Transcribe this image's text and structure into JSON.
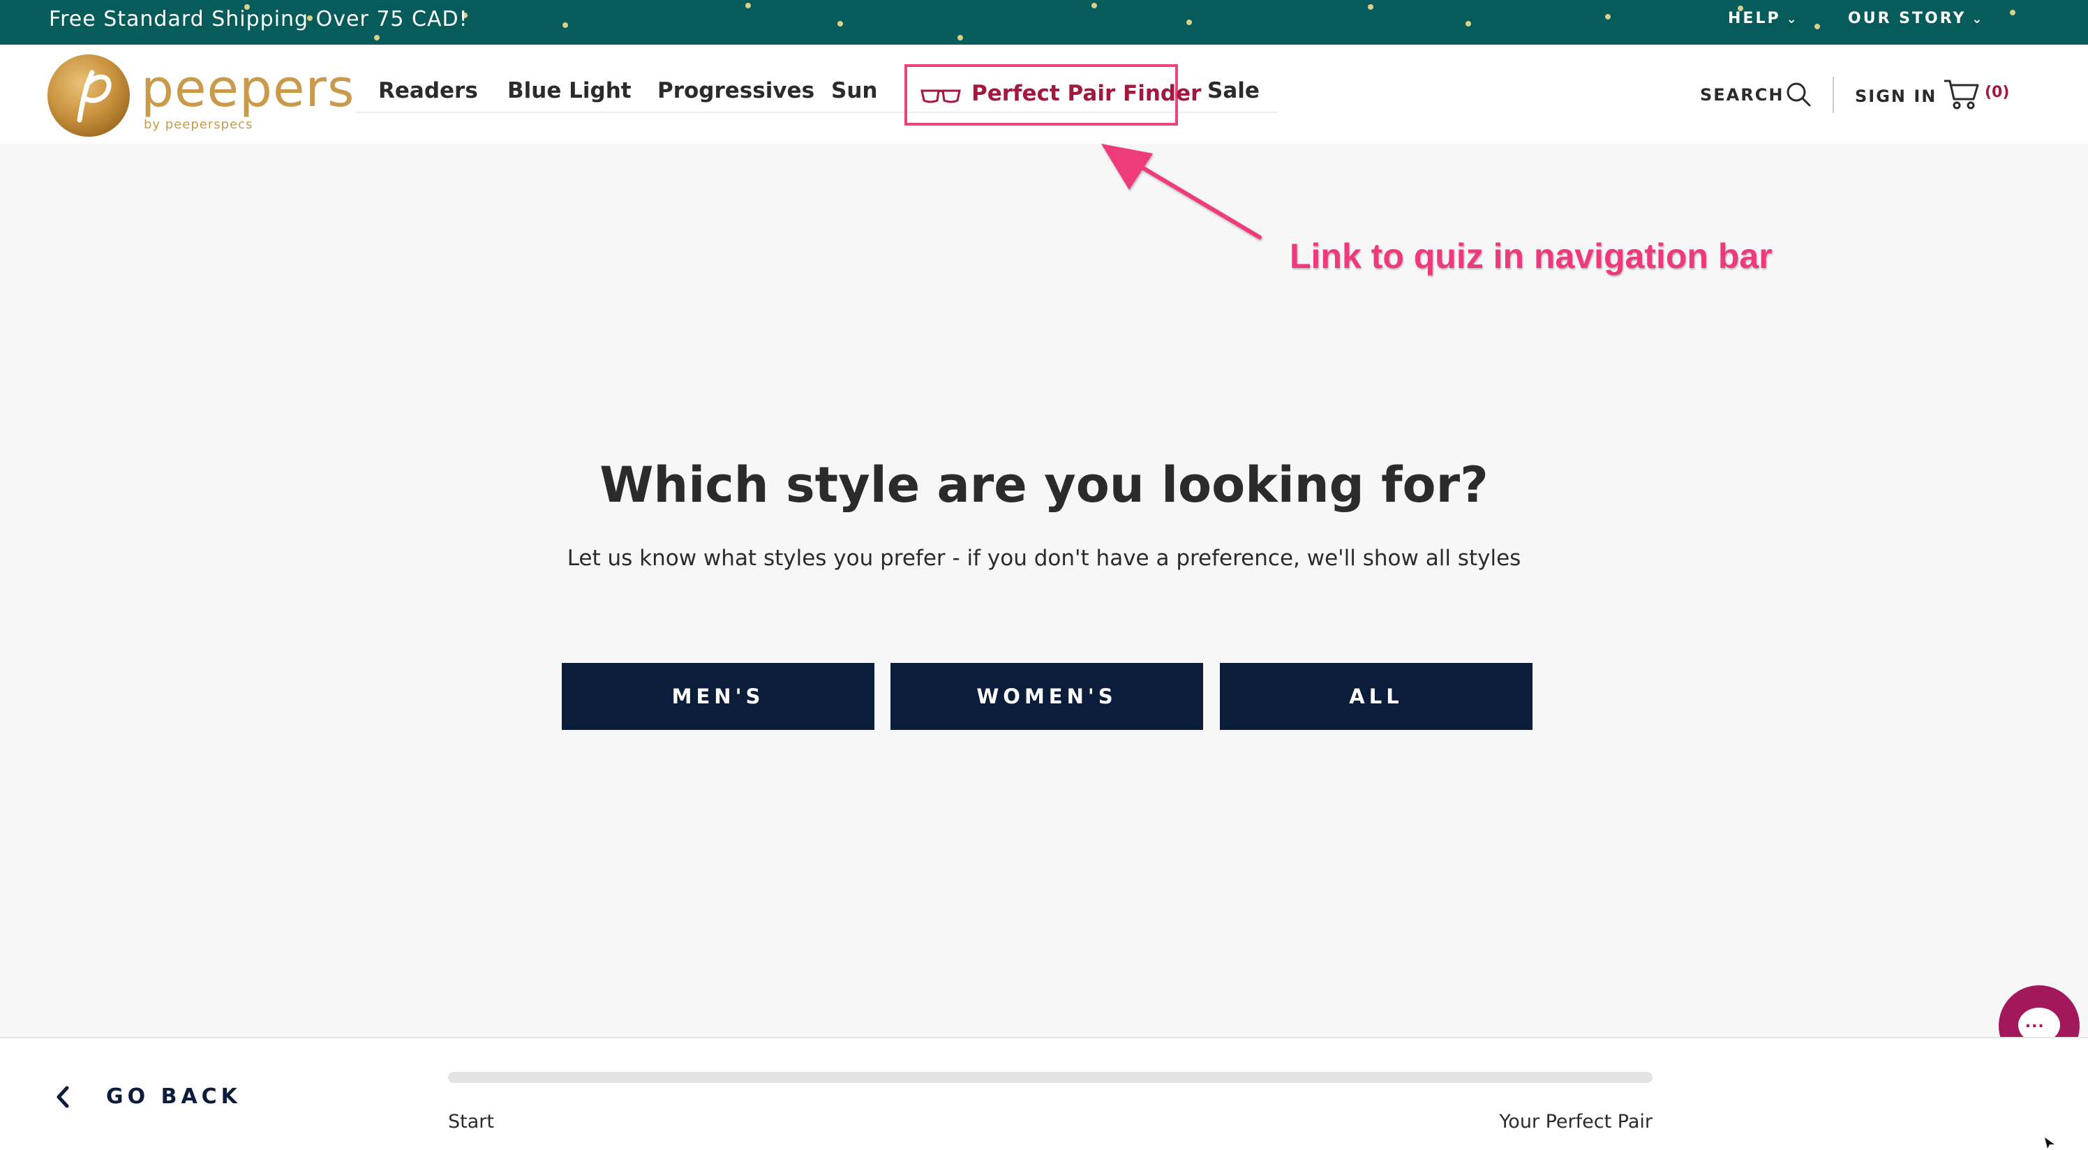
{
  "promo": {
    "text": "Free Standard Shipping Over 75 CAD!",
    "help_label": "HELP",
    "our_story_label": "OUR STORY"
  },
  "header": {
    "logo_word": "peepers",
    "logo_sub": "by peeperspecs",
    "nav": [
      "Readers",
      "Blue Light",
      "Progressives",
      "Sun",
      "Perfect Pair Finder",
      "Sale"
    ],
    "search_label": "SEARCH",
    "signin_label": "SIGN IN",
    "cart_count": "(0)"
  },
  "annotation": {
    "text": "Link to quiz in navigation bar"
  },
  "quiz": {
    "question": "Which style are you looking for?",
    "subtext": "Let us know what styles you prefer - if you don't have a preference, we'll show all styles",
    "choices": [
      "MEN'S",
      "WOMEN'S",
      "ALL"
    ]
  },
  "footer": {
    "go_back": "GO BACK",
    "progress_start": "Start",
    "progress_end": "Your Perfect Pair",
    "progress_fraction": 0.0
  },
  "colors": {
    "promo_bg": "#055c5a",
    "brand_gold": "#c89a4a",
    "accent_red": "#a3183f",
    "annotation_pink": "#ee3a7c",
    "button_navy": "#0c1d3b",
    "chat_magenta": "#a3185b"
  }
}
